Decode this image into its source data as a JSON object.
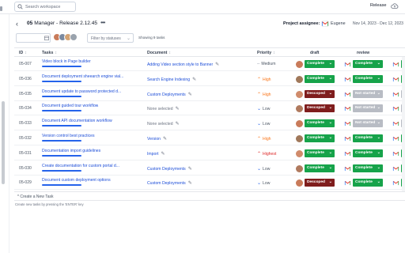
{
  "topbar": {
    "search_placeholder": "Search workspace",
    "release_label": "Release",
    "cloud_icon": "cloud-upload-icon"
  },
  "header": {
    "back": "‹",
    "project_num": "05",
    "project_name": "Manager - Release 2.12.45",
    "menu": "•••",
    "assignee_label": "Project assignee:",
    "assignee_name": "Eugene",
    "date_range": "Nov 14, 2023 - Dec 12, 2023"
  },
  "filters": {
    "status_placeholder": "Filter by statuses",
    "showing": "Showing 9 tasks"
  },
  "table": {
    "headers": {
      "id": "ID",
      "tasks": "Tasks",
      "document": "Document",
      "priority": "Priority",
      "draft": "draft",
      "review": "review"
    },
    "rows": [
      {
        "id": "05-007",
        "task": "Video block in Page builder",
        "doc": "Adding Video section style to Banner",
        "doc_none": false,
        "priority": "Medium",
        "prio_kind": "medium",
        "draft": "Complete",
        "draft_kind": "complete",
        "review": "Complete",
        "review_kind": "complete"
      },
      {
        "id": "05-036",
        "task": "Document deployment sheearch engine vial...",
        "doc": "Search Engine Indexing",
        "doc_none": false,
        "priority": "High",
        "prio_kind": "high",
        "draft": "Complete",
        "draft_kind": "complete",
        "review": "Complete",
        "review_kind": "complete"
      },
      {
        "id": "05-035",
        "task": "Document update to password protected d...",
        "doc": "Custom Deployments",
        "doc_none": false,
        "priority": "High",
        "prio_kind": "high",
        "draft": "Descoped",
        "draft_kind": "descoped",
        "review": "Not started",
        "review_kind": "notstarted"
      },
      {
        "id": "05-034",
        "task": "Document guided tour workflow",
        "doc": "None selected",
        "doc_none": true,
        "priority": "Low",
        "prio_kind": "low",
        "draft": "Descoped",
        "draft_kind": "descoped",
        "review": "Not started",
        "review_kind": "notstarted"
      },
      {
        "id": "05-033",
        "task": "Document API documentation workflow",
        "doc": "None selected",
        "doc_none": true,
        "priority": "Low",
        "prio_kind": "low",
        "draft": "Complete",
        "draft_kind": "complete",
        "review": "Not started",
        "review_kind": "notstarted"
      },
      {
        "id": "05-032",
        "task": "Version control best practices",
        "doc": "Version",
        "doc_none": false,
        "priority": "High",
        "prio_kind": "high",
        "draft": "Complete",
        "draft_kind": "complete",
        "review": "Complete",
        "review_kind": "complete"
      },
      {
        "id": "05-031",
        "task": "Documentation import guidelines",
        "doc": "Import",
        "doc_none": false,
        "priority": "Highest",
        "prio_kind": "highest",
        "draft": "Complete",
        "draft_kind": "complete",
        "review": "Complete",
        "review_kind": "complete"
      },
      {
        "id": "05-030",
        "task": "Create documentation for custom portal d...",
        "doc": "Custom Deployments",
        "doc_none": false,
        "priority": "Low",
        "prio_kind": "low",
        "draft": "Complete",
        "draft_kind": "complete",
        "review": "Complete",
        "review_kind": "complete"
      },
      {
        "id": "05-029",
        "task": "Document custom deployment options",
        "doc": "Custom Deployments",
        "doc_none": false,
        "priority": "Low",
        "prio_kind": "low",
        "draft": "Descoped",
        "draft_kind": "descoped",
        "review": "Complete",
        "review_kind": "complete"
      }
    ]
  },
  "add_task": {
    "label": "* Create a New Task",
    "hint": "Create new tasks by pressing the 'ENTER' key"
  },
  "colors": {
    "link": "#1d4ed8",
    "complete": "#16a34a",
    "descoped": "#7f1d1d",
    "not_started": "#b8bcc4",
    "high": "#f97316",
    "highest": "#dc2626",
    "low": "#2563eb",
    "medium": "#9ca3af"
  }
}
